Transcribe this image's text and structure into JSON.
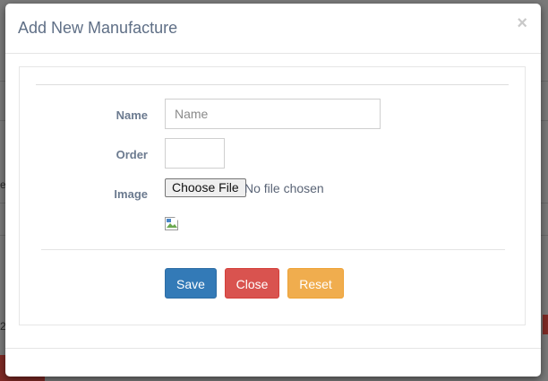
{
  "modal": {
    "title": "Add New Manufacture",
    "close_icon": "×"
  },
  "form": {
    "name_label": "Name",
    "name_placeholder": "Name",
    "name_value": "",
    "order_label": "Order",
    "order_value": "",
    "image_label": "Image",
    "file_button_label": "Choose File",
    "file_status": "No file chosen"
  },
  "buttons": {
    "save": "Save",
    "close": "Close",
    "reset": "Reset"
  },
  "background": {
    "edge_char_1": "e",
    "edge_char_2": "2"
  },
  "colors": {
    "save": "#337ab7",
    "close": "#d9534f",
    "reset": "#f0ad4e",
    "title": "#5f6f86"
  }
}
